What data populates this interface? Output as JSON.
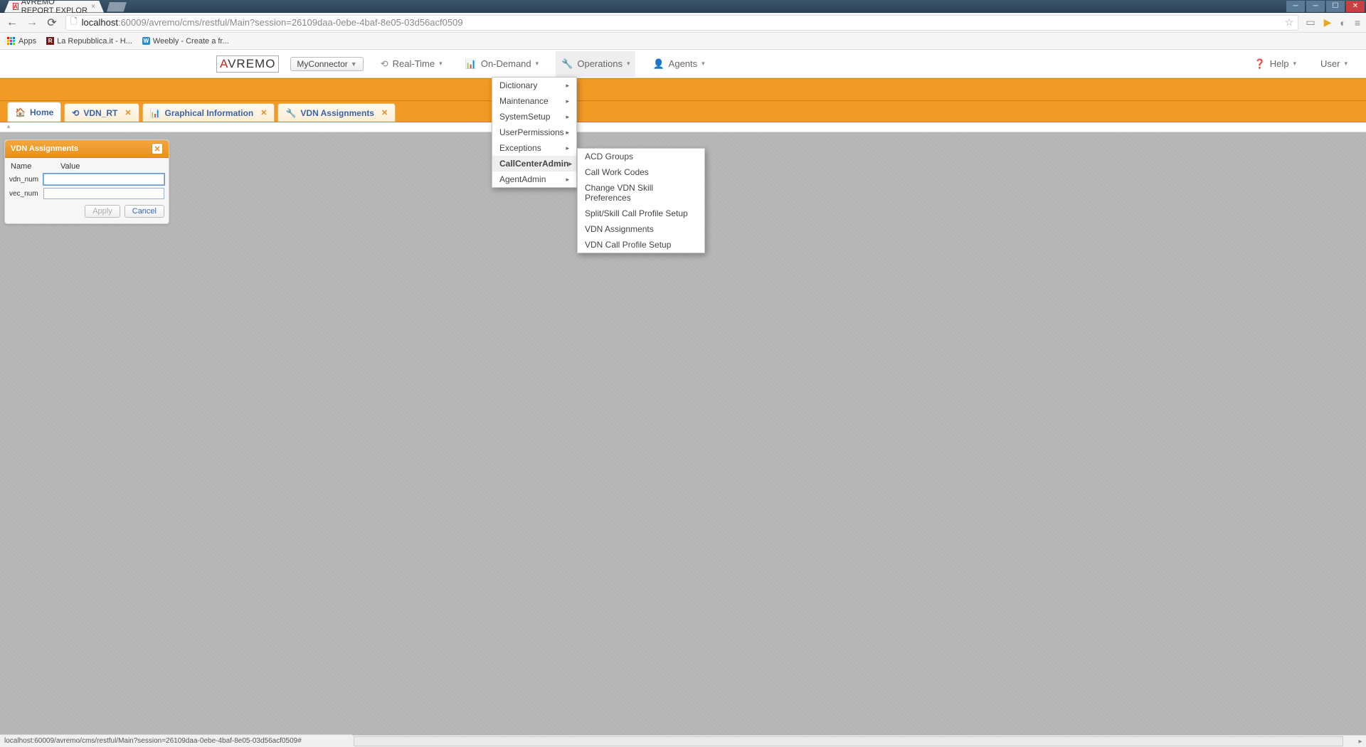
{
  "browser": {
    "tab_title": "AVREMO REPORT EXPLOR",
    "url_host": "localhost",
    "url_port": ":60009",
    "url_path": "/avremo/cms/restful/Main?session=26109daa-0ebe-4baf-8e05-03d56acf0509",
    "bookmarks": {
      "apps": "Apps",
      "repubblica": "La Repubblica.it - H...",
      "weebly": "Weebly - Create a fr..."
    },
    "status": "localhost:60009/avremo/cms/restful/Main?session=26109daa-0ebe-4baf-8e05-03d56acf0509#"
  },
  "app": {
    "logo": "AVREMO",
    "connector": "MyConnector",
    "menu": {
      "realtime": "Real-Time",
      "ondemand": "On-Demand",
      "operations": "Operations",
      "agents": "Agents",
      "help": "Help",
      "user": "User"
    }
  },
  "tabs": [
    {
      "label": "Home",
      "icon": "home"
    },
    {
      "label": "VDN_RT",
      "icon": "refresh"
    },
    {
      "label": "Graphical Information",
      "icon": "chart"
    },
    {
      "label": "VDN Assignments",
      "icon": "wrench"
    }
  ],
  "panel": {
    "title": "VDN Assignments",
    "col_name": "Name",
    "col_value": "Value",
    "fields": [
      {
        "name": "vdn_num",
        "value": ""
      },
      {
        "name": "vec_num",
        "value": ""
      }
    ],
    "apply": "Apply",
    "cancel": "Cancel"
  },
  "operations_menu": [
    "Dictionary",
    "Maintenance",
    "SystemSetup",
    "UserPermissions",
    "Exceptions",
    "CallCenterAdmin",
    "AgentAdmin"
  ],
  "callcenter_submenu": [
    "ACD Groups",
    "Call Work Codes",
    "Change VDN Skill Preferences",
    "Split/Skill Call Profile Setup",
    "VDN Assignments",
    "VDN Call Profile Setup"
  ]
}
